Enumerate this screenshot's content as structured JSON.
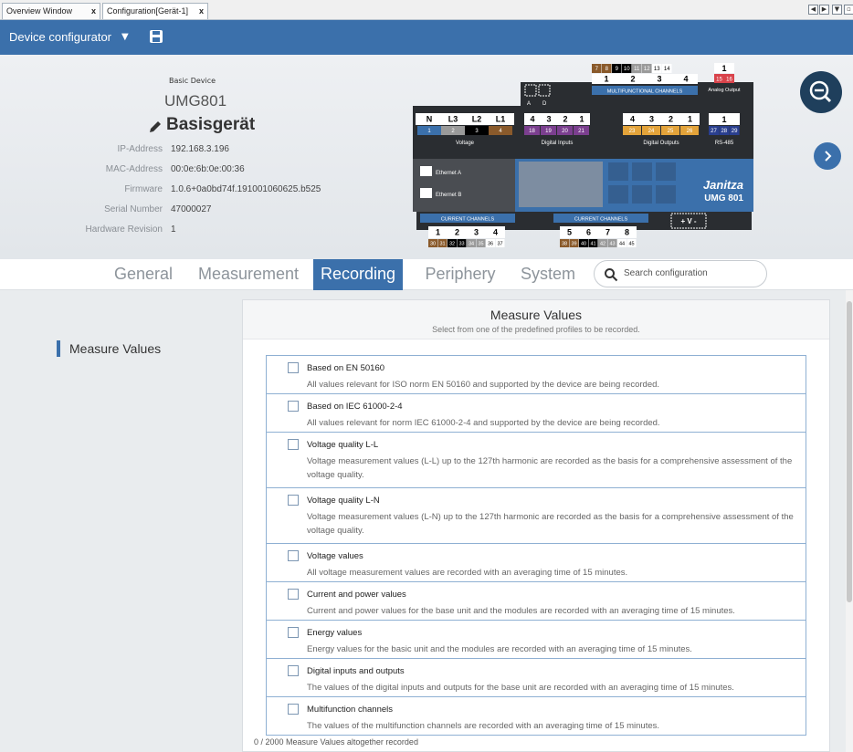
{
  "tabs": [
    {
      "label": "Overview Window",
      "close": "x"
    },
    {
      "label": "Configuration[Gerät-1]",
      "close": "x"
    }
  ],
  "toolbar": {
    "title": "Device configurator"
  },
  "device": {
    "basic_label": "Basic Device",
    "model": "UMG801",
    "name": "Basisgerät",
    "properties": [
      {
        "key": "IP-Address",
        "value": "192.168.3.196"
      },
      {
        "key": "MAC-Address",
        "value": "00:0e:6b:0e:00:36"
      },
      {
        "key": "Firmware",
        "value": "1.0.6+0a0bd74f.191001060625.b525"
      },
      {
        "key": "Serial Number",
        "value": "47000027"
      },
      {
        "key": "Hardware Revision",
        "value": "1"
      }
    ]
  },
  "graphic": {
    "top_terminals": [
      "7",
      "8",
      "9",
      "10",
      "11",
      "12",
      "13",
      "14"
    ],
    "mfc_channels": [
      "1",
      "2",
      "3",
      "4"
    ],
    "mfc_label": "MULTIFUNCTIONAL CHANNELS",
    "ad_label_a": "A",
    "ad_label_d": "D",
    "analog_num": "1",
    "analog_terms": [
      "15",
      "16"
    ],
    "analog_label": "Analog Output",
    "voltage_heads": [
      "N",
      "L3",
      "L2",
      "L1"
    ],
    "voltage_terms": [
      "1",
      "2",
      "3",
      "4"
    ],
    "voltage_label": "Voltage",
    "din_heads": [
      "4",
      "3",
      "2",
      "1"
    ],
    "din_terms": [
      "18",
      "19",
      "20",
      "21"
    ],
    "din_label": "Digital Inputs",
    "dout_heads": [
      "4",
      "3",
      "2",
      "1"
    ],
    "dout_terms": [
      "23",
      "24",
      "25",
      "26"
    ],
    "dout_label": "Digital Outputs",
    "rs_head": "1",
    "rs_terms": [
      "27",
      "28",
      "29"
    ],
    "rs_label": "RS-485",
    "eth_a": "Ethernet A",
    "eth_b": "Ethernet B",
    "brand": "Janitza",
    "brand_model": "UMG 801",
    "cc_label": "CURRENT CHANNELS",
    "cc1_heads": [
      "1",
      "2",
      "3",
      "4"
    ],
    "cc1_terms": [
      "30",
      "31",
      "32",
      "33",
      "34",
      "35",
      "36",
      "37"
    ],
    "cc2_heads": [
      "5",
      "6",
      "7",
      "8"
    ],
    "cc2_terms": [
      "38",
      "39",
      "40",
      "41",
      "42",
      "43",
      "44",
      "45"
    ],
    "pwr_label": "+ V -"
  },
  "nav": {
    "tabs": [
      "General",
      "Measurement",
      "Recording",
      "Periphery",
      "System"
    ],
    "active": "Recording",
    "search_placeholder": "Search configuration"
  },
  "sidebar": {
    "item": "Measure Values"
  },
  "panel": {
    "title": "Measure Values",
    "subtitle": "Select from one of the predefined profiles to be recorded.",
    "options": [
      {
        "title": "Based on EN 50160",
        "desc": "All values relevant for ISO norm EN 50160 and supported by the device are being recorded.",
        "checked": false
      },
      {
        "title": "Based on IEC 61000-2-4",
        "desc": "All values relevant for norm IEC 61000-2-4 and supported by the device are being recorded.",
        "checked": false
      },
      {
        "title": "Voltage quality L-L",
        "desc": "Voltage measurement values (L-L) up to the 127th harmonic are recorded as the basis for a comprehensive assessment of the voltage quality.",
        "checked": false
      },
      {
        "title": "Voltage quality L-N",
        "desc": "Voltage measurement values (L-N) up to the 127th harmonic are recorded as the basis for a comprehensive assessment of the voltage quality.",
        "checked": false
      },
      {
        "title": "Voltage values",
        "desc": "All voltage measurement values are recorded with an averaging time of 15 minutes.",
        "checked": false
      },
      {
        "title": "Current and power values",
        "desc": "Current and power values for the base unit and the modules are recorded with an averaging time of 15 minutes.",
        "checked": false
      },
      {
        "title": "Energy values",
        "desc": "Energy values for the basic unit and the modules are recorded with an averaging time of 15 minutes.",
        "checked": false
      },
      {
        "title": "Digital inputs and outputs",
        "desc": "The values of the digital inputs and outputs for the base unit are recorded with an averaging time of 15 minutes.",
        "checked": false
      },
      {
        "title": "Multifunction channels",
        "desc": "The values of the multifunction channels are recorded with an averaging time of 15 minutes.",
        "checked": false
      }
    ],
    "count_text": "0 / 2000 Measure Values altogether recorded"
  },
  "colors": {
    "accent": "#3b70ab",
    "dark": "#1f3f5c"
  }
}
